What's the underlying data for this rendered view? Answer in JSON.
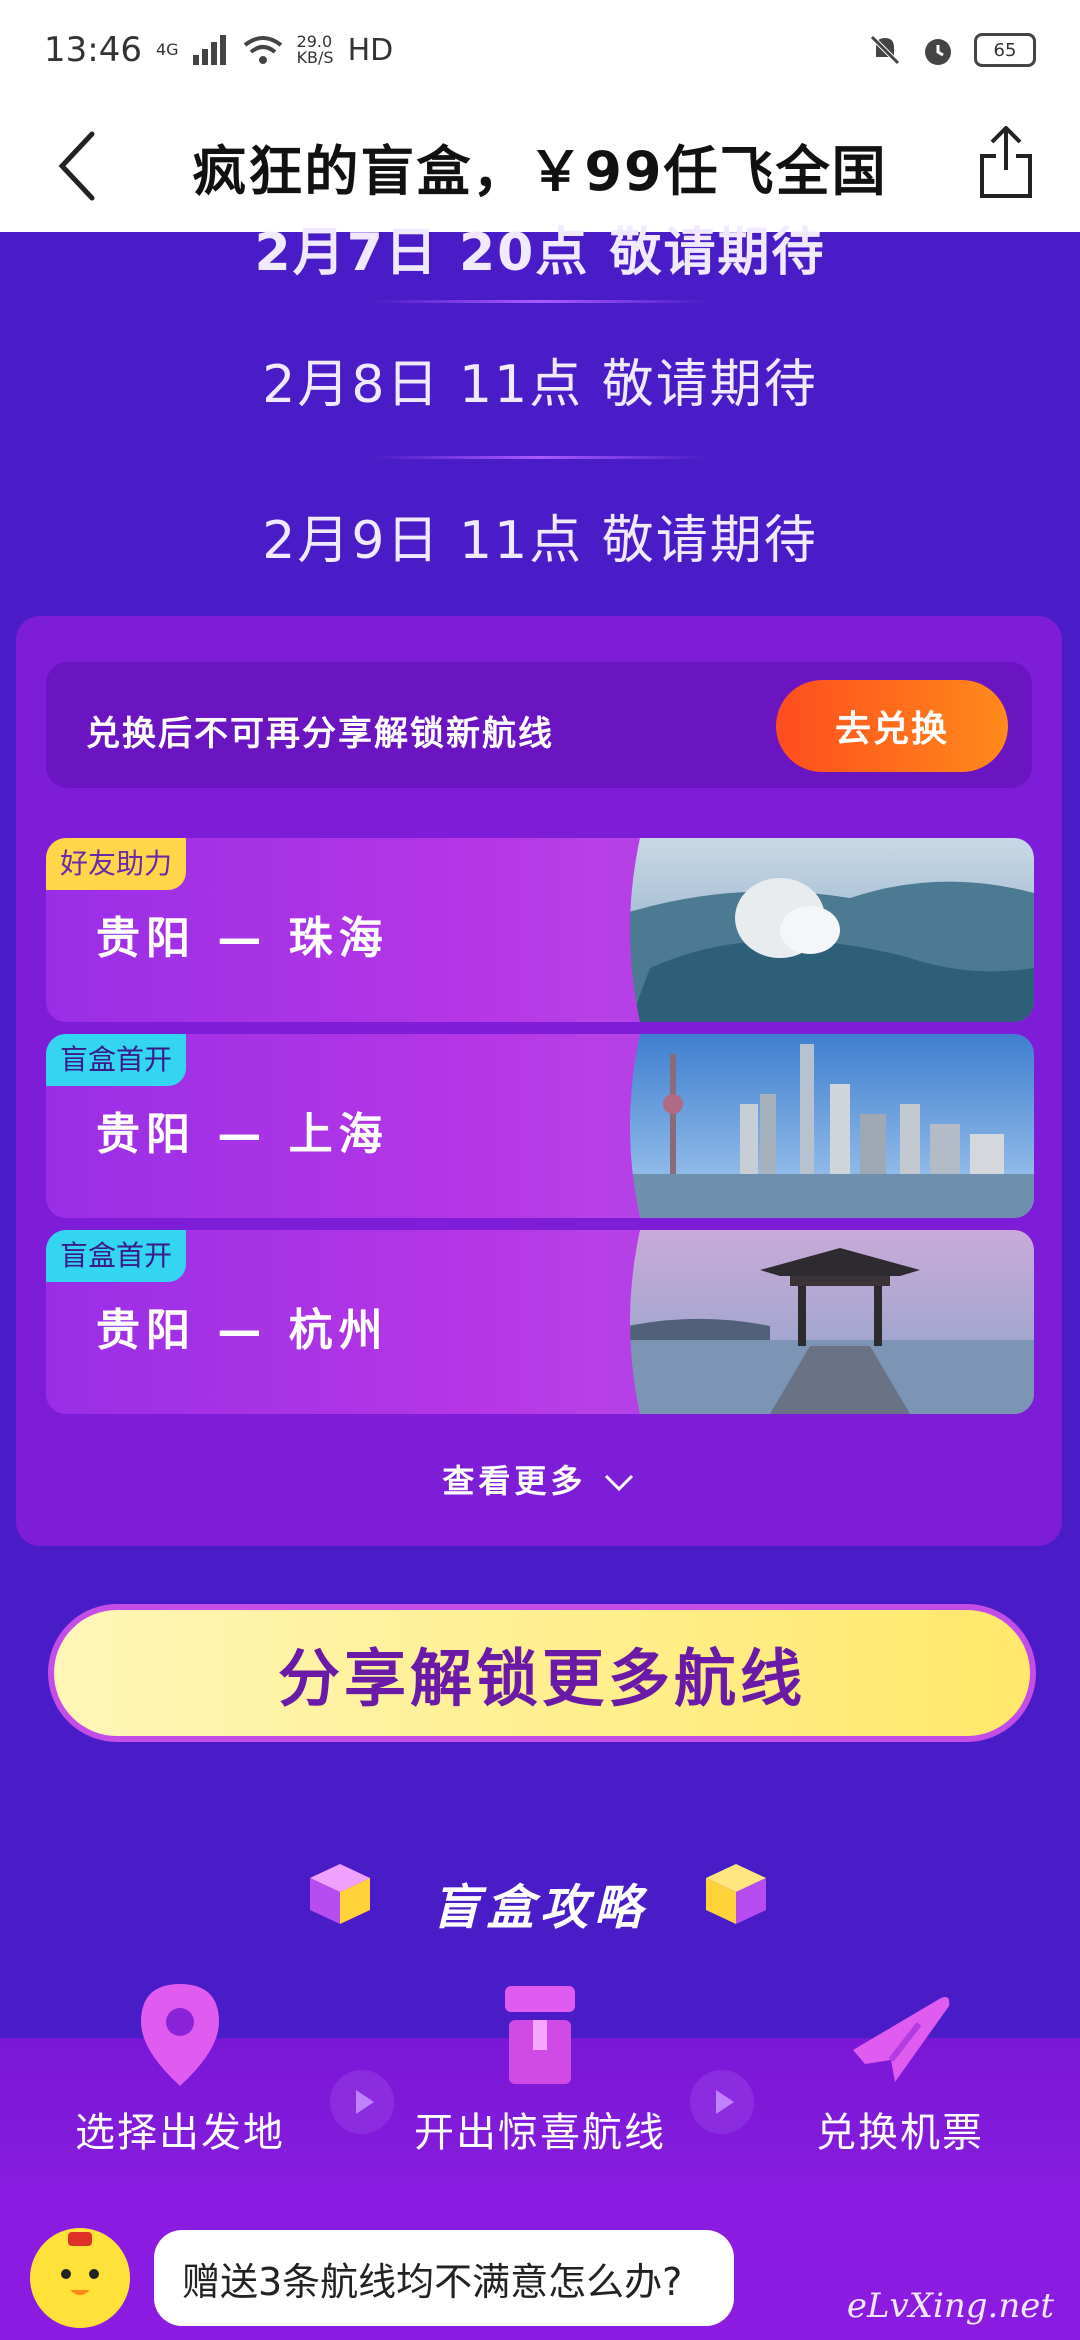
{
  "status": {
    "time": "13:46",
    "network": "4G",
    "speed": "29.0",
    "speed_unit": "KB/S",
    "hd": "HD",
    "battery": "65"
  },
  "nav": {
    "title": "疯狂的盲盒，￥99任飞全国",
    "back_icon": "chevron-left-icon",
    "share_icon": "share-icon"
  },
  "schedule": [
    "2月7日 20点 敬请期待",
    "2月8日 11点 敬请期待",
    "2月9日 11点 敬请期待"
  ],
  "notice": {
    "text": "兑换后不可再分享解锁新航线",
    "button": "去兑换"
  },
  "routes": [
    {
      "tag": "好友助力",
      "tag_color": "#ffd54a",
      "name": "贵阳 — 珠海"
    },
    {
      "tag": "盲盒首开",
      "tag_color": "#33d5f0",
      "name": "贵阳 — 上海"
    },
    {
      "tag": "盲盒首开",
      "tag_color": "#33d5f0",
      "name": "贵阳 — 杭州"
    }
  ],
  "more_label": "查看更多",
  "share_button": "分享解锁更多航线",
  "strategy_title": "盲盒攻略",
  "steps": [
    {
      "label": "选择出发地",
      "icon": "map-pin-icon"
    },
    {
      "label": "开出惊喜航线",
      "icon": "gift-box-icon"
    },
    {
      "label": "兑换机票",
      "icon": "airplane-icon"
    }
  ],
  "chat": {
    "question": "赠送3条航线均不满意怎么办?"
  },
  "watermark": "eLvXing.net"
}
